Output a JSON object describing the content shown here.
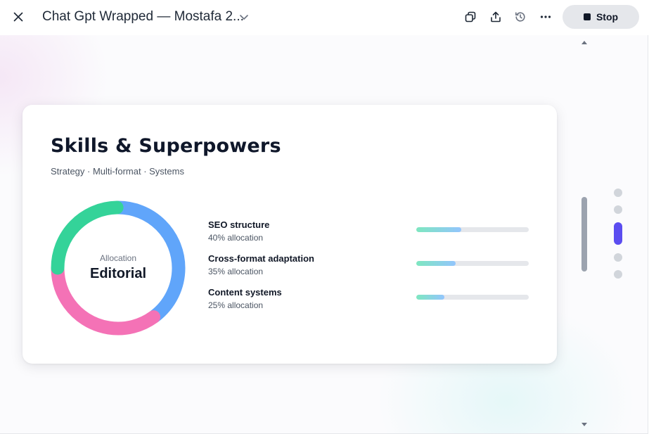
{
  "window": {
    "title": "Chat Gpt Wrapped — Mostafa 2...",
    "stop_label": "Stop"
  },
  "icons": {
    "close": "close-icon",
    "title_menu": "chevron-down-icon",
    "copy": "copy-icon",
    "share": "share-icon",
    "history": "history-icon",
    "more": "more-icon",
    "stop": "stop-square-icon"
  },
  "card": {
    "title": "Skills & Superpowers",
    "subtitle": "Strategy · Multi-format · Systems",
    "donut": {
      "label": "Allocation",
      "center": "Editorial",
      "segments": [
        {
          "share": 0.4,
          "color": "#60a5fa"
        },
        {
          "share": 0.35,
          "color": "#f472b6"
        },
        {
          "share": 0.25,
          "color": "#34d399"
        }
      ]
    },
    "skills": [
      {
        "name": "SEO structure",
        "detail": "40% allocation",
        "level": 0.4
      },
      {
        "name": "Cross-format adaptation",
        "detail": "35% allocation",
        "level": 0.35
      },
      {
        "name": "Content systems",
        "detail": "25% allocation",
        "level": 0.25
      }
    ]
  },
  "pager": {
    "total": 5,
    "active": 3
  },
  "colors": {
    "accent": "#5b4df0",
    "blue": "#60a5fa",
    "pink": "#f472b6",
    "green": "#34d399"
  }
}
